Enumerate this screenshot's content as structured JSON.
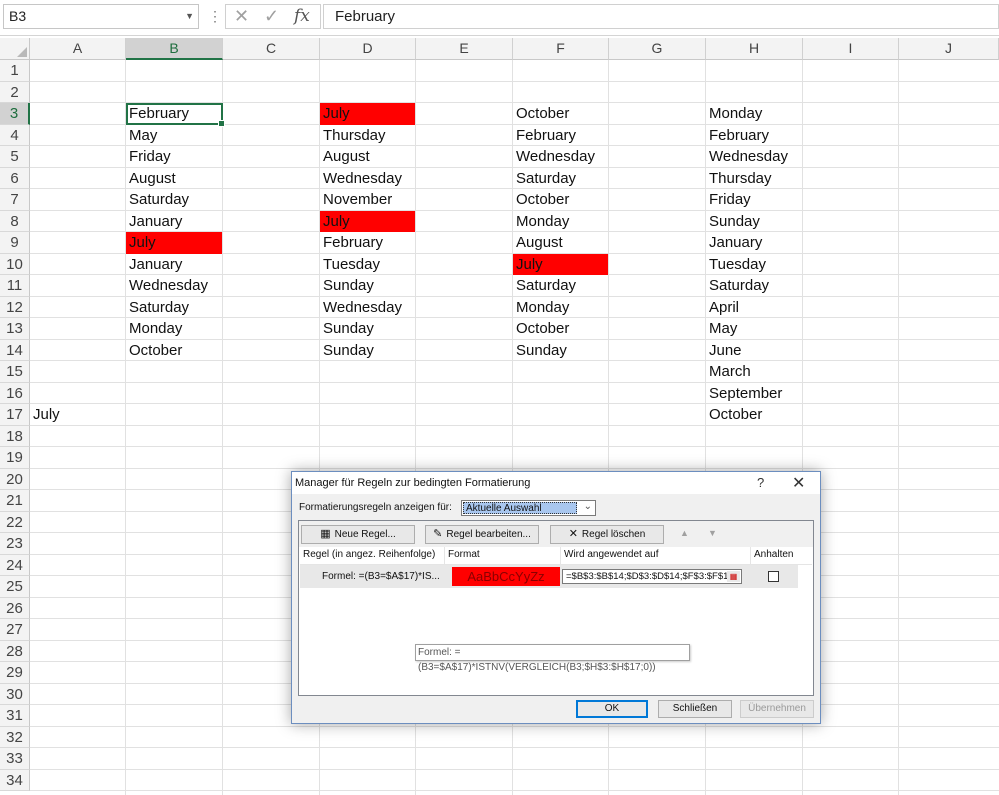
{
  "formula_bar": {
    "name_box": "B3",
    "cancel_icon": "✕",
    "enter_icon": "✓",
    "function_label": "fx",
    "content": "February"
  },
  "columns": [
    "A",
    "B",
    "C",
    "D",
    "E",
    "F",
    "G",
    "H",
    "I",
    "J"
  ],
  "selected_column": "B",
  "rows": [
    "1",
    "2",
    "3",
    "4",
    "5",
    "6",
    "7",
    "8",
    "9",
    "10",
    "11",
    "12",
    "13",
    "14",
    "15",
    "16",
    "17",
    "18",
    "19",
    "20",
    "21",
    "22",
    "23",
    "24",
    "25",
    "26",
    "27",
    "28",
    "29",
    "30",
    "31",
    "32",
    "33",
    "34"
  ],
  "selected_row": "3",
  "active_cell": "B3",
  "highlight_color": "#ff0000",
  "cells": {
    "A": {
      "17": "July"
    },
    "B": {
      "3": "February",
      "4": "May",
      "5": "Friday",
      "6": "August",
      "7": "Saturday",
      "8": "January",
      "9": "July",
      "10": "January",
      "11": "Wednesday",
      "12": "Saturday",
      "13": "Monday",
      "14": "October"
    },
    "D": {
      "3": "July",
      "4": "Thursday",
      "5": "August",
      "6": "Wednesday",
      "7": "November",
      "8": "July",
      "9": "February",
      "10": "Tuesday",
      "11": "Sunday",
      "12": "Wednesday",
      "13": "Sunday",
      "14": "Sunday"
    },
    "F": {
      "3": "October",
      "4": "February",
      "5": "Wednesday",
      "6": "Saturday",
      "7": "October",
      "8": "Monday",
      "9": "August",
      "10": "July",
      "11": "Saturday",
      "12": "Monday",
      "13": "October",
      "14": "Sunday"
    },
    "H": {
      "3": "Monday",
      "4": "February",
      "5": "Wednesday",
      "6": "Thursday",
      "7": "Friday",
      "8": "Sunday",
      "9": "January",
      "10": "Tuesday",
      "11": "Saturday",
      "12": "April",
      "13": "May",
      "14": "June",
      "15": "March",
      "16": "September",
      "17": "October"
    }
  },
  "highlighted_cells": [
    "B9",
    "D3",
    "D8",
    "F10"
  ],
  "dialog": {
    "title": "Manager für Regeln zur bedingten Formatierung",
    "help_label": "?",
    "close_label": "✕",
    "show_rules_label": "Formatierungsregeln anzeigen für:",
    "show_rules_value": "Aktuelle Auswahl",
    "new_rule": "Neue Regel...",
    "edit_rule": "Regel bearbeiten...",
    "delete_rule": "Regel löschen",
    "move_up": "▲",
    "move_down": "▼",
    "columns": {
      "rule": "Regel (in angez. Reihenfolge)",
      "format": "Format",
      "applies_to": "Wird angewendet auf",
      "stop": "Anhalten"
    },
    "rule": {
      "formula": "Formel: =(B3=$A$17)*IS...",
      "format_preview": "AaBbCcYyZz",
      "applies_to": "=$B$3:$B$14;$D$3:$D$14;$F$3:$F$1",
      "stop_checked": false
    },
    "tooltip": "Formel: =(B3=$A$17)*ISTNV(VERGLEICH(B3;$H$3:$H$17;0))",
    "ok": "OK",
    "close": "Schließen",
    "apply": "Übernehmen"
  }
}
